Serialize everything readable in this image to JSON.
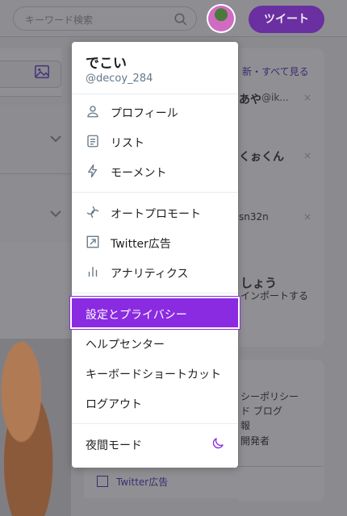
{
  "search": {
    "placeholder": "キーワード検索"
  },
  "header": {
    "tweet_label": "ツイート"
  },
  "menu": {
    "name": "でこい",
    "handle": "@decoy_284",
    "group1": [
      {
        "label": "プロフィール",
        "icon": "person-icon"
      },
      {
        "label": "リスト",
        "icon": "list-icon"
      },
      {
        "label": "モーメント",
        "icon": "lightning-icon"
      }
    ],
    "group2": [
      {
        "label": "オートプロモート",
        "icon": "promote-icon"
      },
      {
        "label": "Twitter広告",
        "icon": "ads-icon"
      },
      {
        "label": "アナリティクス",
        "icon": "analytics-icon"
      }
    ],
    "group3": [
      {
        "label": "設定とプライバシー"
      },
      {
        "label": "ヘルプセンター"
      },
      {
        "label": "キーボードショートカット"
      },
      {
        "label": "ログアウト"
      }
    ],
    "night_mode": "夜間モード",
    "accent": "#8a2be2"
  },
  "background": {
    "right_refresh": "新・すべて見る",
    "users": [
      {
        "name": "あや",
        "handle": "@ik..."
      },
      {
        "name": "くぉくん"
      },
      {
        "name": "sn32n"
      }
    ],
    "suggest_title": "しょう",
    "suggest_sub": "インポートする",
    "footer_links": [
      "シーポリシー",
      "ド ブログ",
      "報",
      "開発者"
    ],
    "ad_link": "Twitter広告",
    "close_glyph": "×"
  }
}
